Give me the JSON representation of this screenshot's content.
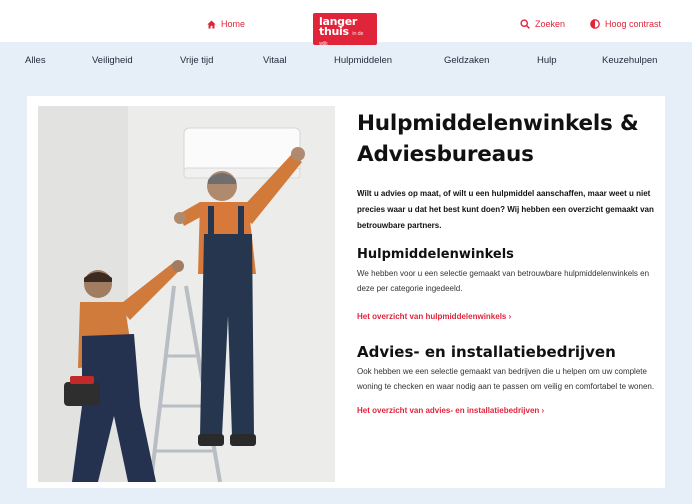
{
  "header": {
    "home_label": "Home",
    "logo_line1": "langer",
    "logo_line2": "thuis",
    "logo_small": "in de wijk",
    "search_label": "Zoeken",
    "contrast_label": "Hoog contrast"
  },
  "nav": {
    "items": [
      "Alles",
      "Veiligheid",
      "Vrije tijd",
      "Vitaal",
      "Hulpmiddelen",
      "Geldzaken",
      "Hulp",
      "Keuzehulpen"
    ]
  },
  "main": {
    "title": "Hulpmiddelenwinkels & Adviesbureaus",
    "intro": "Wilt u advies op maat, of wilt u een hulpmiddel aanschaffen, maar weet u niet precies waar u dat het best kunt doen? Wij hebben een overzicht gemaakt van betrouwbare partners.",
    "section1": {
      "heading": "Hulpmiddelenwinkels",
      "body": "We hebben voor u een selectie gemaakt van betrouwbare hulpmiddelenwinkels en deze per categorie ingedeeld.",
      "link": "Het overzicht van hulpmiddelenwinkels ›"
    },
    "section2": {
      "heading": "Advies- en installatiebedrijven",
      "body": "Ook hebben we een selectie gemaakt van bedrijven die u helpen om uw complete woning te checken en waar nodig aan te passen om veilig en comfortabel te wonen.",
      "link": "Het overzicht van advies- en installatiebedrijven ›"
    }
  },
  "colors": {
    "accent": "#e0253b",
    "nav_bg": "#e6eff7"
  },
  "icons": {
    "home": "home-icon",
    "search": "search-icon",
    "contrast": "contrast-icon"
  }
}
